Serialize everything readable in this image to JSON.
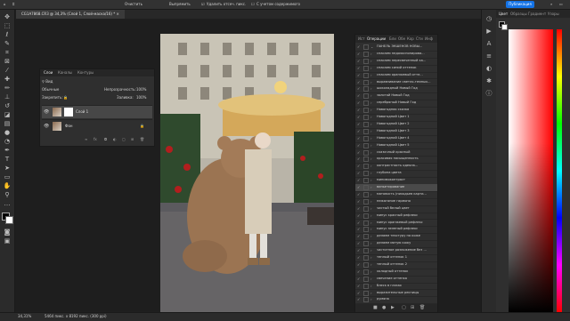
{
  "optionsbar": {
    "items": [
      "Очистить",
      "Выпрямить",
      "Удалить отсеч. пикс.",
      "С учетом содержимого"
    ],
    "publish_label": "Публикация"
  },
  "document": {
    "tab_title": "CG1A7868.CR3 @ 34,3% (Слой 1, Слой-маска/16) *"
  },
  "layers_panel": {
    "tabs": [
      "Слои",
      "Каналы",
      "Контуры"
    ],
    "filter_label": "Вид",
    "blend_mode": "Обычные",
    "opacity_label": "Непрозрачность:",
    "opacity_value": "100%",
    "lock_label": "Закрепить:",
    "fill_label": "Заливка:",
    "fill_value": "100%",
    "layers": [
      {
        "name": "Слой 1",
        "has_mask": true
      },
      {
        "name": "Фон",
        "has_mask": false
      }
    ]
  },
  "actions_panel": {
    "tabs": [
      "Ист",
      "Операции",
      "Бли",
      "Обе",
      "Кор",
      "Сти",
      "Инф"
    ],
    "items": [
      "ПАНЕЛЬ ЭКШЕНОВ НОВЫ...",
      "спасаем недоэкспонирова...",
      "спасаем пересвеченный ка...",
      "спасаем синий оттенок",
      "спасаем оранжевый отте...",
      "выравнивание светло-темных...",
      "шоколадный Новый Год",
      "золотой Новый Год",
      "серебряный Новый Год",
      "Новогодняя сказка",
      "Новогодний Цвет 1",
      "Новогодний Цвет 2",
      "Новогодний Цвет 3",
      "Новогодний Цвет 4",
      "Новогодний Цвет 5",
      "сказочный красный",
      "красивая насыщенность",
      "контрастность одеяла...",
      "глубина цвета",
      "минимоконтраст",
      "виньетирование",
      "матовость (ниходьев карти...",
      "нежагание гармоно",
      "чистый белый цвет",
      "минус красный рефлекс",
      "минус оранжевый рефлекс",
      "минус зеленый рефлекс",
      "делаем текстуру на коже",
      "делаем матую кожу",
      "частотное разложение без ...",
      "теплый оттенок 1",
      "теплый оттенок 2",
      "холодный оттенок",
      "свечение оттенка",
      "блеск в глазах",
      "выразительные ресницы",
      "румяна",
      "белоснежные зубы"
    ],
    "selected_index": 20
  },
  "color_panel": {
    "tabs": [
      "Цвет",
      "Образцы",
      "Градиент",
      "Узоры"
    ]
  },
  "status": {
    "zoom": "34,31%",
    "info": "5464 пикс. x 8192 пикс. (300 ppi)"
  },
  "colors": {
    "accent": "#1473e6",
    "panel_bg": "#2f2f2f",
    "app_bg": "#1f1f1f"
  }
}
